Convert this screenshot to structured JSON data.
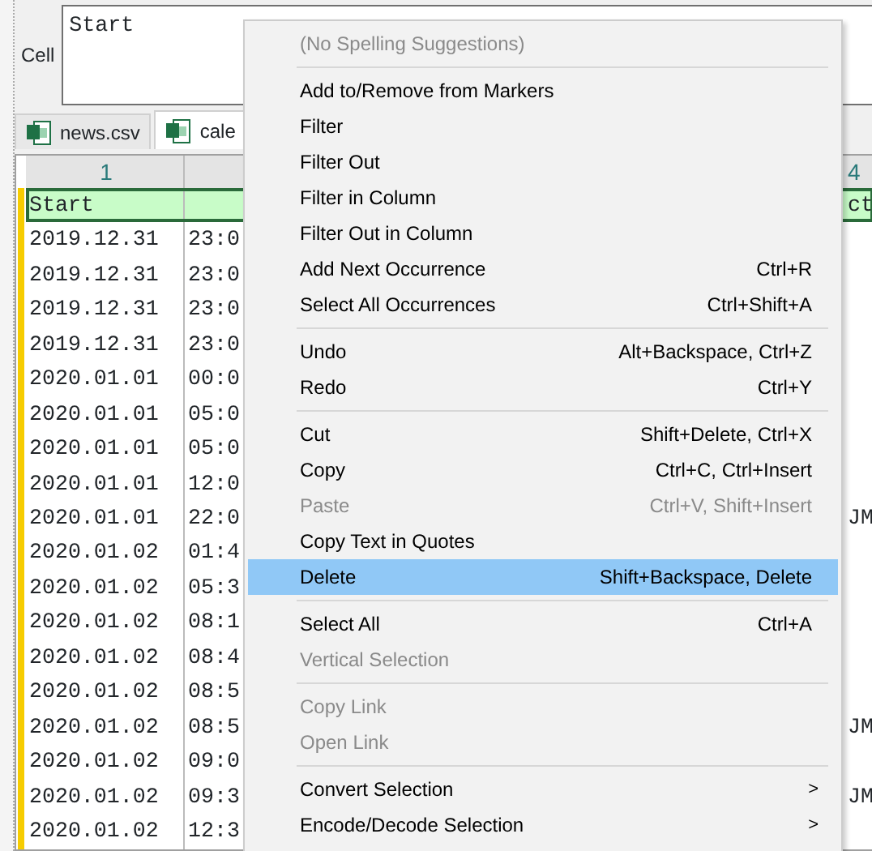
{
  "cell_editor": {
    "label": "Cell",
    "value": "Start"
  },
  "tabs": [
    {
      "label": "news.csv",
      "selected": false
    },
    {
      "label": "cale",
      "selected": true
    }
  ],
  "grid": {
    "columns": [
      {
        "header": "1"
      },
      {},
      {},
      {
        "header": "4"
      }
    ],
    "rows": [
      {
        "cells": [
          "Start",
          "",
          "",
          "ct"
        ],
        "selected": true
      },
      {
        "cells": [
          "2019.12.31",
          "23:0",
          "",
          ""
        ],
        "selected": false
      },
      {
        "cells": [
          "2019.12.31",
          "23:0",
          "",
          ""
        ],
        "selected": false
      },
      {
        "cells": [
          "2019.12.31",
          "23:0",
          "",
          ""
        ],
        "selected": false
      },
      {
        "cells": [
          "2019.12.31",
          "23:0",
          "",
          ""
        ],
        "selected": false
      },
      {
        "cells": [
          "2020.01.01",
          "00:0",
          "",
          ""
        ],
        "selected": false
      },
      {
        "cells": [
          "2020.01.01",
          "05:0",
          "",
          ""
        ],
        "selected": false
      },
      {
        "cells": [
          "2020.01.01",
          "05:0",
          "",
          ""
        ],
        "selected": false
      },
      {
        "cells": [
          "2020.01.01",
          "12:0",
          "",
          ""
        ],
        "selected": false
      },
      {
        "cells": [
          "2020.01.01",
          "22:0",
          "",
          "JM"
        ],
        "selected": false
      },
      {
        "cells": [
          "2020.01.02",
          "01:4",
          "",
          ""
        ],
        "selected": false
      },
      {
        "cells": [
          "2020.01.02",
          "05:3",
          "",
          ""
        ],
        "selected": false
      },
      {
        "cells": [
          "2020.01.02",
          "08:1",
          "",
          ""
        ],
        "selected": false
      },
      {
        "cells": [
          "2020.01.02",
          "08:4",
          "",
          ""
        ],
        "selected": false
      },
      {
        "cells": [
          "2020.01.02",
          "08:5",
          "",
          ""
        ],
        "selected": false
      },
      {
        "cells": [
          "2020.01.02",
          "08:5",
          "",
          "JM"
        ],
        "selected": false
      },
      {
        "cells": [
          "2020.01.02",
          "09:0",
          "",
          ""
        ],
        "selected": false
      },
      {
        "cells": [
          "2020.01.02",
          "09:3",
          "",
          "JM"
        ],
        "selected": false
      },
      {
        "cells": [
          "2020.01.02",
          "12:3",
          "",
          ""
        ],
        "selected": false
      }
    ]
  },
  "context_menu": [
    {
      "kind": "item",
      "label": "(No Spelling Suggestions)",
      "disabled": true,
      "selected": false
    },
    {
      "kind": "separator"
    },
    {
      "kind": "item",
      "label": "Add to/Remove from Markers",
      "disabled": false,
      "selected": false
    },
    {
      "kind": "item",
      "label": "Filter",
      "disabled": false,
      "selected": false
    },
    {
      "kind": "item",
      "label": "Filter Out",
      "disabled": false,
      "selected": false
    },
    {
      "kind": "item",
      "label": "Filter in Column",
      "disabled": false,
      "selected": false
    },
    {
      "kind": "item",
      "label": "Filter Out in Column",
      "disabled": false,
      "selected": false
    },
    {
      "kind": "item",
      "label": "Add Next Occurrence",
      "shortcut": "Ctrl+R",
      "disabled": false,
      "selected": false
    },
    {
      "kind": "item",
      "label": "Select All Occurrences",
      "shortcut": "Ctrl+Shift+A",
      "disabled": false,
      "selected": false
    },
    {
      "kind": "separator"
    },
    {
      "kind": "item",
      "label": "Undo",
      "shortcut": "Alt+Backspace, Ctrl+Z",
      "disabled": false,
      "selected": false
    },
    {
      "kind": "item",
      "label": "Redo",
      "shortcut": "Ctrl+Y",
      "disabled": false,
      "selected": false
    },
    {
      "kind": "separator"
    },
    {
      "kind": "item",
      "label": "Cut",
      "shortcut": "Shift+Delete, Ctrl+X",
      "disabled": false,
      "selected": false
    },
    {
      "kind": "item",
      "label": "Copy",
      "shortcut": "Ctrl+C, Ctrl+Insert",
      "disabled": false,
      "selected": false
    },
    {
      "kind": "item",
      "label": "Paste",
      "shortcut": "Ctrl+V, Shift+Insert",
      "disabled": true,
      "selected": false
    },
    {
      "kind": "item",
      "label": "Copy Text in Quotes",
      "disabled": false,
      "selected": false
    },
    {
      "kind": "item",
      "label": "Delete",
      "shortcut": "Shift+Backspace, Delete",
      "disabled": false,
      "selected": true
    },
    {
      "kind": "separator"
    },
    {
      "kind": "item",
      "label": "Select All",
      "shortcut": "Ctrl+A",
      "disabled": false,
      "selected": false
    },
    {
      "kind": "item",
      "label": "Vertical Selection",
      "disabled": true,
      "selected": false
    },
    {
      "kind": "separator"
    },
    {
      "kind": "item",
      "label": "Copy Link",
      "disabled": true,
      "selected": false
    },
    {
      "kind": "item",
      "label": "Open Link",
      "disabled": true,
      "selected": false
    },
    {
      "kind": "separator"
    },
    {
      "kind": "item",
      "label": "Convert Selection",
      "submenu_arrow": ">",
      "disabled": false,
      "selected": false
    },
    {
      "kind": "item",
      "label": "Encode/Decode Selection",
      "submenu_arrow": ">",
      "disabled": false,
      "selected": false
    }
  ]
}
